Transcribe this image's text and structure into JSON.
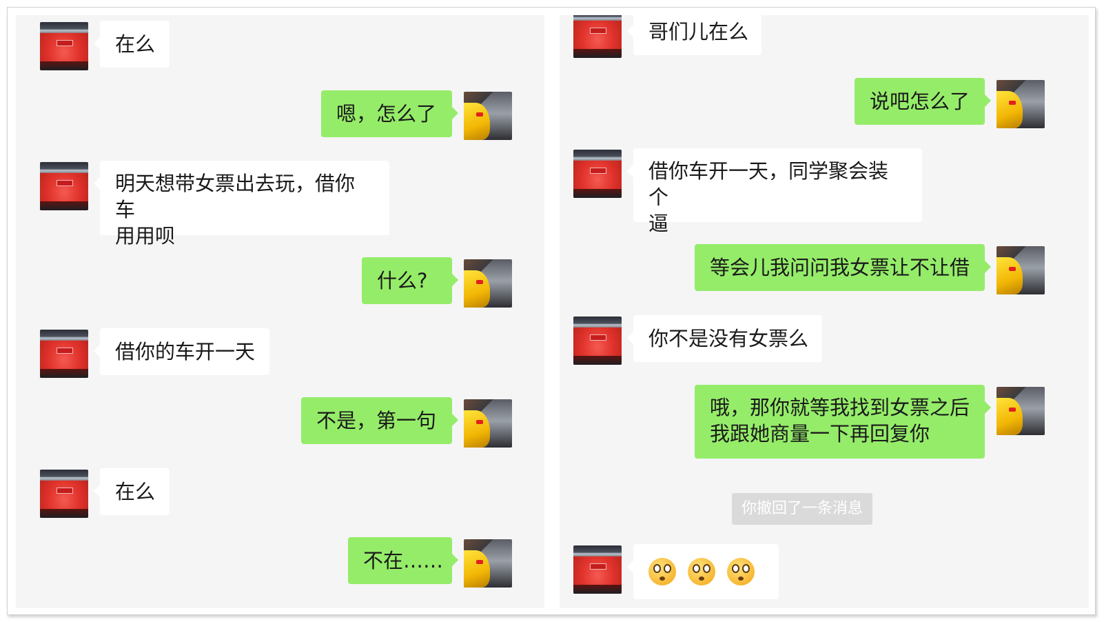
{
  "left_panel": {
    "messages": [
      {
        "from": "friend",
        "text": "在么"
      },
      {
        "from": "me",
        "text": "嗯，怎么了"
      },
      {
        "from": "friend",
        "lines": [
          "明天想带女票出去玩，借你车",
          "用用呗"
        ]
      },
      {
        "from": "me",
        "text": "什么?"
      },
      {
        "from": "friend",
        "text": "借你的车开一天"
      },
      {
        "from": "me",
        "text": "不是，第一句"
      },
      {
        "from": "friend",
        "text": "在么"
      },
      {
        "from": "me",
        "text": "不在……"
      }
    ]
  },
  "right_panel": {
    "messages": [
      {
        "from": "friend",
        "text": "哥们儿在么"
      },
      {
        "from": "me",
        "text": "说吧怎么了"
      },
      {
        "from": "friend",
        "lines": [
          "借你车开一天，同学聚会装个",
          "逼"
        ]
      },
      {
        "from": "me",
        "text": "等会儿我问问我女票让不让借"
      },
      {
        "from": "friend",
        "text": "你不是没有女票么"
      },
      {
        "from": "me",
        "lines": [
          "哦，那你就等我找到女票之后",
          "我跟她商量一下再回复你"
        ]
      }
    ],
    "system_notice": "你撤回了一条消息",
    "last_message": {
      "from": "friend",
      "emoji": [
        "flushed-face",
        "flushed-face",
        "flushed-face"
      ]
    }
  },
  "colors": {
    "background": "#f5f5f5",
    "incoming_bubble": "#ffffff",
    "outgoing_bubble": "#95ec69",
    "system_notice_bg": "#dadada"
  }
}
